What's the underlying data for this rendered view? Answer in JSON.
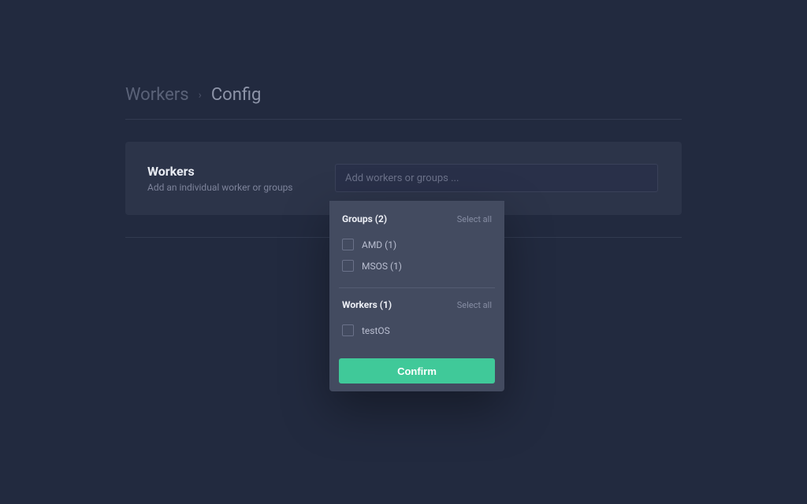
{
  "breadcrumb": {
    "root": "Workers",
    "separator": "›",
    "current": "Config"
  },
  "panel": {
    "title": "Workers",
    "subtitle": "Add an individual worker or groups",
    "input_placeholder": "Add workers or groups ..."
  },
  "dropdown": {
    "groups": {
      "header": "Groups (2)",
      "select_all": "Select all",
      "items": [
        {
          "label": "AMD (1)"
        },
        {
          "label": "MSOS (1)"
        }
      ]
    },
    "workers": {
      "header": "Workers (1)",
      "select_all": "Select all",
      "items": [
        {
          "label": "testOS"
        }
      ]
    },
    "confirm_label": "Confirm"
  },
  "colors": {
    "bg": "#222a3f",
    "panel": "#2c3449",
    "dropdown": "#434b60",
    "accent": "#40c999"
  }
}
